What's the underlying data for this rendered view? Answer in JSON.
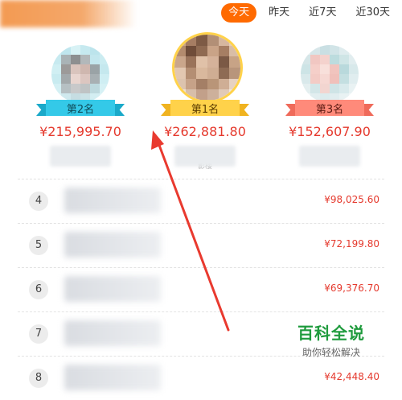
{
  "tabs": [
    {
      "label": "今天",
      "active": true
    },
    {
      "label": "昨天",
      "active": false
    },
    {
      "label": "近7天",
      "active": false
    },
    {
      "label": "近30天",
      "active": false
    }
  ],
  "podium": [
    {
      "rank_label": "第2名",
      "amount": "¥215,995.70",
      "ribbon_color": "#34c9e8"
    },
    {
      "rank_label": "第1名",
      "amount": "¥262,881.80",
      "ribbon_color": "#ffc93a",
      "sub": "影楼"
    },
    {
      "rank_label": "第3名",
      "amount": "¥152,607.90",
      "ribbon_color": "#ff8a7a"
    }
  ],
  "ranking": [
    {
      "rank": "4",
      "amount": "¥98,025.60"
    },
    {
      "rank": "5",
      "amount": "¥72,199.80"
    },
    {
      "rank": "6",
      "amount": "¥69,376.70"
    },
    {
      "rank": "7",
      "amount": ""
    },
    {
      "rank": "8",
      "amount": "¥42,448.40"
    }
  ],
  "watermark": {
    "title": "百科全说",
    "subtitle": "助你轻松解决"
  }
}
